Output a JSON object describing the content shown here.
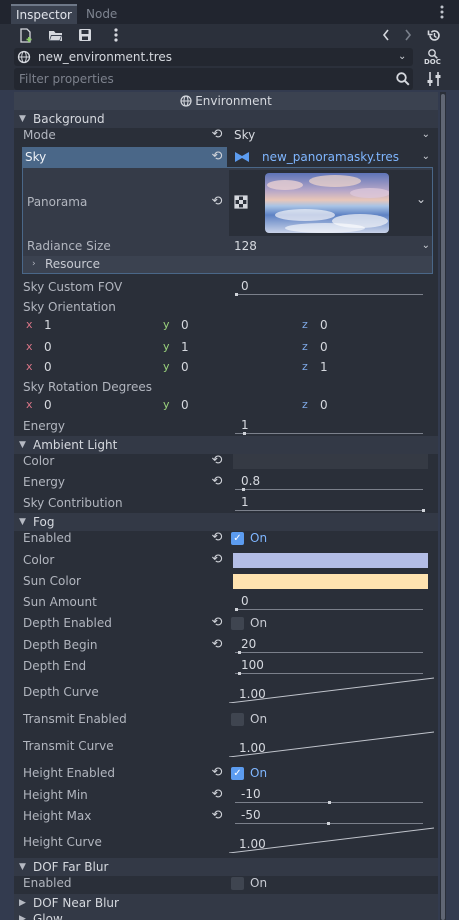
{
  "tabs": [
    {
      "label": "Inspector",
      "active": true
    },
    {
      "label": "Node",
      "active": false
    }
  ],
  "toolbar": {
    "new_icon": "new-resource-icon",
    "open_icon": "folder-icon",
    "save_icon": "save-icon",
    "menu_icon": "kebab-icon",
    "back_icon": "chevron-left-icon",
    "forward_icon": "chevron-right-icon",
    "history_icon": "history-icon"
  },
  "path": {
    "file": "new_environment.tres",
    "doc_label": "DOC"
  },
  "filter": {
    "placeholder": "Filter properties"
  },
  "resource_title": "Environment",
  "background": {
    "section": "Background",
    "mode_label": "Mode",
    "mode_value": "Sky",
    "sky_label": "Sky",
    "sky_value": "new_panoramasky.tres",
    "panorama_label": "Panorama",
    "radiance_label": "Radiance Size",
    "radiance_value": "128",
    "resource_label": "Resource",
    "custom_fov_label": "Sky Custom FOV",
    "custom_fov_value": "0",
    "orientation_label": "Sky Orientation",
    "orientation_rows": [
      [
        "1",
        "0",
        "0"
      ],
      [
        "0",
        "1",
        "0"
      ],
      [
        "0",
        "0",
        "1"
      ]
    ],
    "rotation_label": "Sky Rotation Degrees",
    "rotation_values": [
      "0",
      "0",
      "0"
    ],
    "energy_label": "Energy",
    "energy_value": "1",
    "axis_x": "x",
    "axis_y": "y",
    "axis_z": "z"
  },
  "ambient": {
    "section": "Ambient Light",
    "color_label": "Color",
    "energy_label": "Energy",
    "energy_value": "0.8",
    "sky_contrib_label": "Sky Contribution",
    "sky_contrib_value": "1"
  },
  "fog": {
    "section": "Fog",
    "enabled_label": "Enabled",
    "enabled_value": "On",
    "color_label": "Color",
    "color_hex": "#b3bde6",
    "sun_color_label": "Sun Color",
    "sun_color_hex": "#ffe3b0",
    "sun_amount_label": "Sun Amount",
    "sun_amount_value": "0",
    "depth_enabled_label": "Depth Enabled",
    "depth_enabled_value": "On",
    "depth_begin_label": "Depth Begin",
    "depth_begin_value": "20",
    "depth_end_label": "Depth End",
    "depth_end_value": "100",
    "depth_curve_label": "Depth Curve",
    "depth_curve_value": "1.00",
    "transmit_enabled_label": "Transmit Enabled",
    "transmit_enabled_value": "On",
    "transmit_curve_label": "Transmit Curve",
    "transmit_curve_value": "1.00",
    "height_enabled_label": "Height Enabled",
    "height_enabled_value": "On",
    "height_min_label": "Height Min",
    "height_min_value": "-10",
    "height_max_label": "Height Max",
    "height_max_value": "-50",
    "height_curve_label": "Height Curve",
    "height_curve_value": "1.00"
  },
  "dof_far": {
    "section": "DOF Far Blur",
    "enabled_label": "Enabled",
    "enabled_value": "On"
  },
  "dof_near": {
    "section": "DOF Near Blur"
  },
  "glow": {
    "section": "Glow"
  },
  "colors": {
    "accent": "#5c9cf0",
    "selected_row": "#4a6788",
    "fog_color": "#b3bde6",
    "sun_color": "#ffe3b0"
  }
}
